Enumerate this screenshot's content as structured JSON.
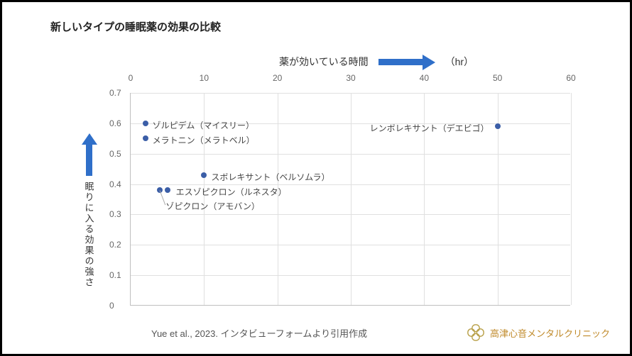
{
  "title": "新しいタイプの睡眠薬の効果の比較",
  "x_axis_label": "薬が効いている時間",
  "x_unit": "（hr）",
  "y_axis_label": "眠りに入る効果の強さ",
  "citation": "Yue et al., 2023. インタビューフォームより引用作成",
  "clinic": "高津心音メンタルクリニック",
  "chart_data": {
    "type": "scatter",
    "xlabel": "薬が効いている時間 (hr)",
    "ylabel": "眠りに入る効果の強さ",
    "xlim": [
      0,
      60
    ],
    "ylim": [
      0,
      0.7
    ],
    "x_ticks": [
      0,
      10,
      20,
      30,
      40,
      50,
      60
    ],
    "y_ticks": [
      0,
      0.1,
      0.2,
      0.3,
      0.4,
      0.5,
      0.6,
      0.7
    ],
    "points": [
      {
        "name": "ゾルピデム（マイスリー）",
        "x": 2,
        "y": 0.6
      },
      {
        "name": "メラトニン（メラトベル）",
        "x": 2,
        "y": 0.55
      },
      {
        "name": "スボレキサント（ベルソムラ）",
        "x": 10,
        "y": 0.43
      },
      {
        "name": "エスゾピクロン（ルネスタ）",
        "x": 5,
        "y": 0.38
      },
      {
        "name": "ゾピクロン（アモバン）",
        "x": 4,
        "y": 0.38
      },
      {
        "name": "レンボレキサント（デエビゴ）",
        "x": 50,
        "y": 0.59
      }
    ]
  }
}
